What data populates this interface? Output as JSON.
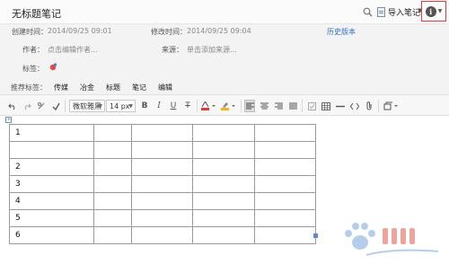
{
  "note": {
    "title": "无标题笔记"
  },
  "header": {
    "import_label": "导入笔记",
    "info_glyph": "i"
  },
  "meta": {
    "created_label": "创建时间：",
    "created_value": "2014/09/25 09:01",
    "modified_label": "修改时间：",
    "modified_value": "2014/09/25 09:04",
    "history_link": "历史版本",
    "author_label": "作者：",
    "author_placeholder": "点击编辑作者...",
    "source_label": "来源：",
    "source_placeholder": "单击添加来源...",
    "tags_label": "标签：",
    "recommended_label": "推荐标签：",
    "recommended_tags": [
      "传媒",
      "冶金",
      "标题",
      "笔记",
      "编辑"
    ]
  },
  "toolbar": {
    "font_family": "微软雅黑",
    "font_size": "14 px",
    "bold_label": "B",
    "italic_label": "I",
    "underline_label": "U",
    "strike_label": "T"
  },
  "table": {
    "rows": [
      [
        "1",
        "",
        "",
        "",
        "",
        ""
      ],
      [
        "",
        "",
        "",
        "",
        "",
        ""
      ],
      [
        "2",
        "",
        "",
        "",
        "",
        ""
      ],
      [
        "3",
        "",
        "",
        "",
        "",
        ""
      ],
      [
        "4",
        "",
        "",
        "",
        "",
        ""
      ],
      [
        "5",
        "",
        "",
        "",
        "",
        ""
      ],
      [
        "6",
        "",
        "",
        "",
        "",
        ""
      ]
    ]
  },
  "colors": {
    "accent_link": "#2f70c9",
    "highlight_border": "#e03a3a",
    "tag_icon": "#e04a4a"
  },
  "icons": [
    "search-icon",
    "import-doc-icon",
    "info-icon",
    "tag-icon",
    "undo-icon",
    "redo-icon",
    "clear-format-icon",
    "format-painter-icon",
    "font-color-icon",
    "highlight-icon",
    "align-left-icon",
    "align-center-icon",
    "align-right-icon",
    "align-justify-icon",
    "checkbox-icon",
    "table-icon",
    "horizontal-rule-icon",
    "code-icon",
    "attachment-icon",
    "insert-icon"
  ]
}
